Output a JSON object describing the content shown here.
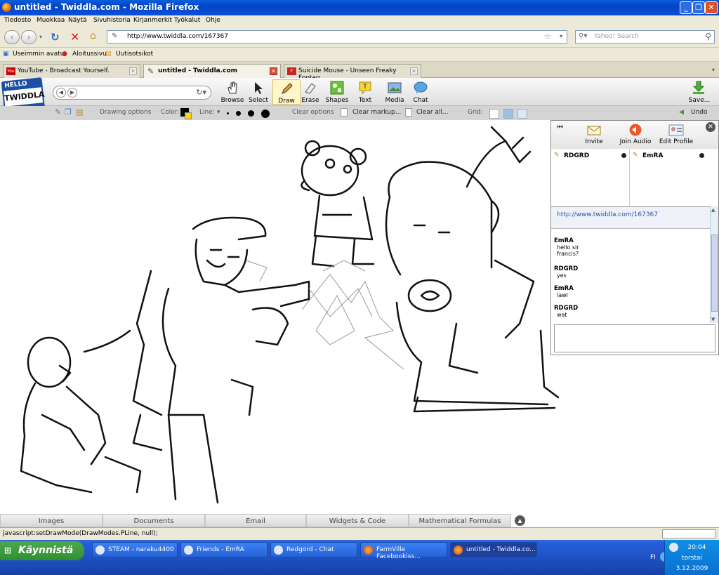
{
  "window": {
    "title": "untitled - Twiddla.com - Mozilla Firefox"
  },
  "menu": [
    "Tiedosto",
    "Muokkaa",
    "Näytä",
    "Sivuhistoria",
    "Kirjanmerkit",
    "Työkalut",
    "Ohje"
  ],
  "nav": {
    "url": "http://www.twiddla.com/167367",
    "search_placeholder": "Yahoo! Search"
  },
  "bookmarks": [
    "Useimmin avatut",
    "Aloitussivu",
    "Uutisotsikot"
  ],
  "tabs": [
    {
      "label": "YouTube - Broadcast Yourself."
    },
    {
      "label": "untitled - Twiddla.com"
    },
    {
      "label": "Suicide Mouse - Unseen Freaky Footag..."
    }
  ],
  "twiddla": {
    "logo_top": "HELLO",
    "logo_name": "TWIDDLA",
    "tools": [
      "Browse",
      "Select",
      "Draw",
      "Erase",
      "Shapes",
      "Text",
      "Media",
      "Chat"
    ],
    "save": "Save...",
    "options": {
      "drawing": "Drawing options",
      "color": "Color:",
      "line": "Line:",
      "clear": "Clear options",
      "clear_markup": "Clear markup...",
      "clear_all": "Clear all...",
      "grid": "Grid:",
      "undo": "Undo"
    }
  },
  "chat": {
    "buttons": [
      "Invite",
      "Join Audio",
      "Edit Profile"
    ],
    "users": [
      "RDGRD",
      "EmRA"
    ],
    "url": "http://www.twiddla.com/167367",
    "messages": [
      {
        "name": "EmRA",
        "text": [
          "hello sir",
          "francis?"
        ]
      },
      {
        "name": "RDGRD",
        "text": [
          "yes"
        ]
      },
      {
        "name": "EmRA",
        "text": [
          "lawl"
        ]
      },
      {
        "name": "RDGRD",
        "text": [
          "wat"
        ]
      }
    ]
  },
  "bottom_tabs": [
    "Images",
    "Documents",
    "Email",
    "Widgets & Code",
    "Mathematical Formulas"
  ],
  "status": "javascript:setDrawMode(DrawModes.PLine, null);",
  "taskbar": {
    "start": "Käynnistä",
    "items": [
      "STEAM - naraku4400",
      "Friends - EmRA",
      "Redgord - Chat",
      "FarmVille Facebookiss...",
      "untitled - Twiddla.co..."
    ],
    "lang": "FI",
    "time": "20:04",
    "day": "torstai",
    "date": "3.12.2009"
  },
  "colors": {
    "titlebar": "#0343c6",
    "taskbar": "#245edb",
    "start": "#2f8f2f",
    "draw_color": "#000000",
    "accent": "#2a50a8"
  }
}
